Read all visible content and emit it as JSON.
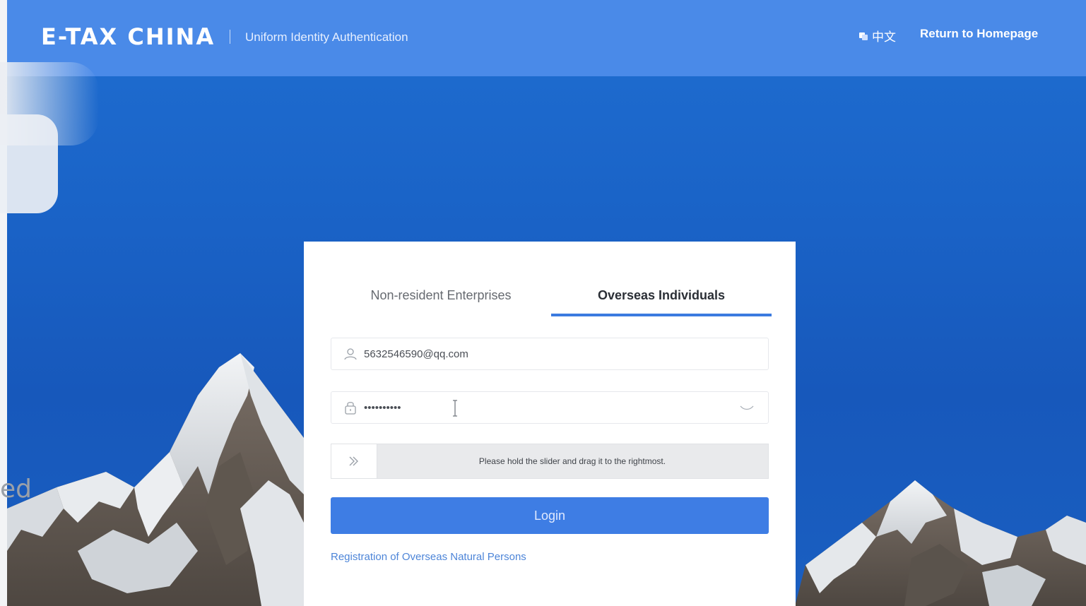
{
  "header": {
    "brand": "E-TAX CHINA",
    "subtitle": "Uniform Identity Authentication",
    "language": "中文",
    "return_home": "Return to Homepage"
  },
  "login": {
    "tabs": [
      {
        "label": "Non-resident Enterprises",
        "active": false
      },
      {
        "label": "Overseas Individuals",
        "active": true
      }
    ],
    "username_value": "5632546590@qq.com",
    "password_value": "••••••••••",
    "slider_text": "Please hold the slider and drag it to the rightmost.",
    "login_label": "Login",
    "register_link": "Registration of Overseas Natural Persons"
  },
  "fragment_text": "ed",
  "colors": {
    "header_bg": "#4a8ae8",
    "accent": "#3e7de4",
    "sky": "#1a63c7"
  },
  "icons": {
    "user": "user-icon",
    "lock": "lock-icon",
    "eye": "eye-closed-icon",
    "slider": "double-chevron-right-icon",
    "language": "language-icon"
  }
}
